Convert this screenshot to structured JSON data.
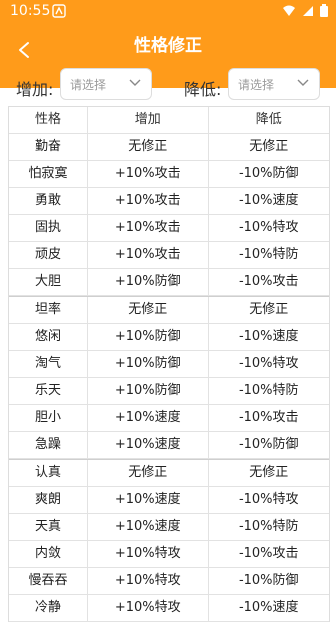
{
  "status": {
    "time": "10:55"
  },
  "header": {
    "title": "性格修正",
    "back_icon": "arrow-left-icon"
  },
  "filters": {
    "increase_label": "增加:",
    "increase_placeholder": "请选择",
    "decrease_label": "降低:",
    "decrease_placeholder": "请选择"
  },
  "table": {
    "columns": [
      "性格",
      "增加",
      "降低"
    ],
    "rows": [
      [
        "勤奋",
        "无修正",
        "无修正"
      ],
      [
        "怕寂寞",
        "+10%攻击",
        "-10%防御"
      ],
      [
        "勇敢",
        "+10%攻击",
        "-10%速度"
      ],
      [
        "固执",
        "+10%攻击",
        "-10%特攻"
      ],
      [
        "顽皮",
        "+10%攻击",
        "-10%特防"
      ],
      [
        "大胆",
        "+10%防御",
        "-10%攻击"
      ],
      [
        "坦率",
        "无修正",
        "无修正"
      ],
      [
        "悠闲",
        "+10%防御",
        "-10%速度"
      ],
      [
        "淘气",
        "+10%防御",
        "-10%特攻"
      ],
      [
        "乐天",
        "+10%防御",
        "-10%特防"
      ],
      [
        "胆小",
        "+10%速度",
        "-10%攻击"
      ],
      [
        "急躁",
        "+10%速度",
        "-10%防御"
      ],
      [
        "认真",
        "无修正",
        "无修正"
      ],
      [
        "爽朗",
        "+10%速度",
        "-10%特攻"
      ],
      [
        "天真",
        "+10%速度",
        "-10%特防"
      ],
      [
        "内敛",
        "+10%特攻",
        "-10%攻击"
      ],
      [
        "慢吞吞",
        "+10%特攻",
        "-10%防御"
      ],
      [
        "冷静",
        "+10%特攻",
        "-10%速度"
      ]
    ]
  },
  "colors": {
    "accent": "#ff9b1a",
    "border": "#e2e2e2"
  }
}
